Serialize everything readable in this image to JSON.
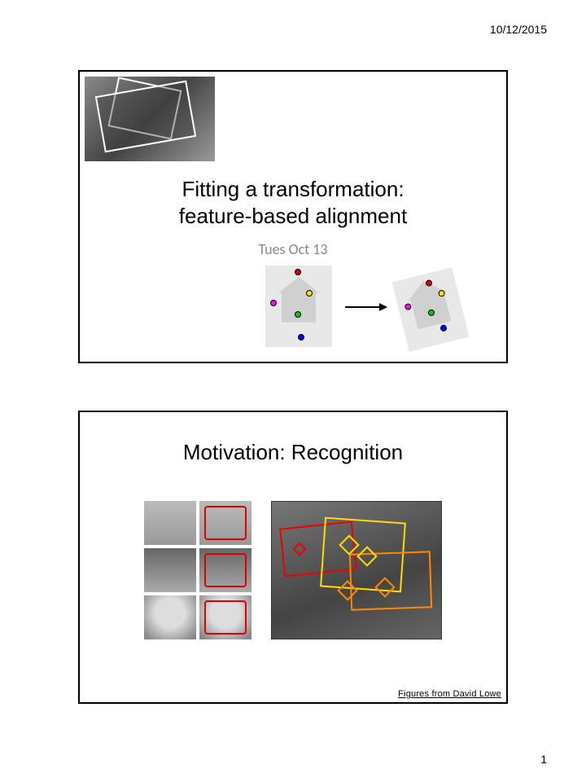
{
  "header": {
    "date": "10/12/2015"
  },
  "footer": {
    "page": "1"
  },
  "slide1": {
    "title_line1": "Fitting a transformation:",
    "title_line2": "feature-based alignment",
    "subtitle": "Tues Oct 13"
  },
  "slide2": {
    "title": "Motivation: Recognition",
    "credit": "Figures from David Lowe"
  }
}
